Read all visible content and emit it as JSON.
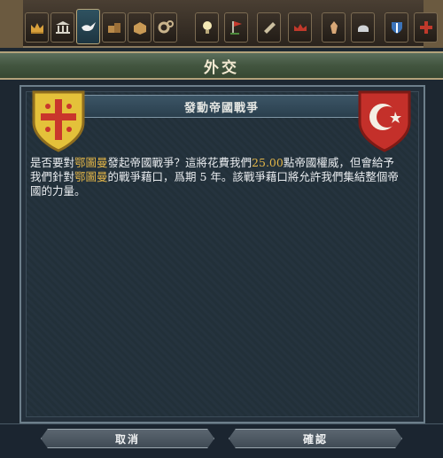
{
  "window": {
    "title": "外交"
  },
  "tabs": [
    {
      "name": "crown-icon"
    },
    {
      "name": "court-icon"
    },
    {
      "name": "dove-icon",
      "active": true
    },
    {
      "name": "trade-icon"
    },
    {
      "name": "economy-icon"
    },
    {
      "name": "gears-icon"
    },
    {
      "name": "idea-icon"
    },
    {
      "name": "flag-icon"
    },
    {
      "name": "scroll-icon"
    },
    {
      "name": "crown-outline-icon"
    },
    {
      "name": "prayer-icon"
    },
    {
      "name": "helmet-icon"
    },
    {
      "name": "shield-icon"
    },
    {
      "name": "cross-icon"
    }
  ],
  "dialog": {
    "heading": "發動帝國戰爭",
    "message": {
      "p1": "是否要對",
      "target1": "鄂圖曼",
      "p2": "發起帝國戰爭？這將花費我們",
      "cost": "25.00",
      "p3": "點帝國權威，但會給予我們針對",
      "target2": "鄂圖曼",
      "p4": "的戰爭藉口，爲期 5 年。該戰爭藉口將允許我們集結整個帝國的力量。"
    }
  },
  "buttons": {
    "cancel": "取消",
    "confirm": "確認"
  },
  "colors": {
    "highlight": "#e2b548",
    "left_shield": "#e4c13a",
    "right_shield": "#c4302a"
  }
}
